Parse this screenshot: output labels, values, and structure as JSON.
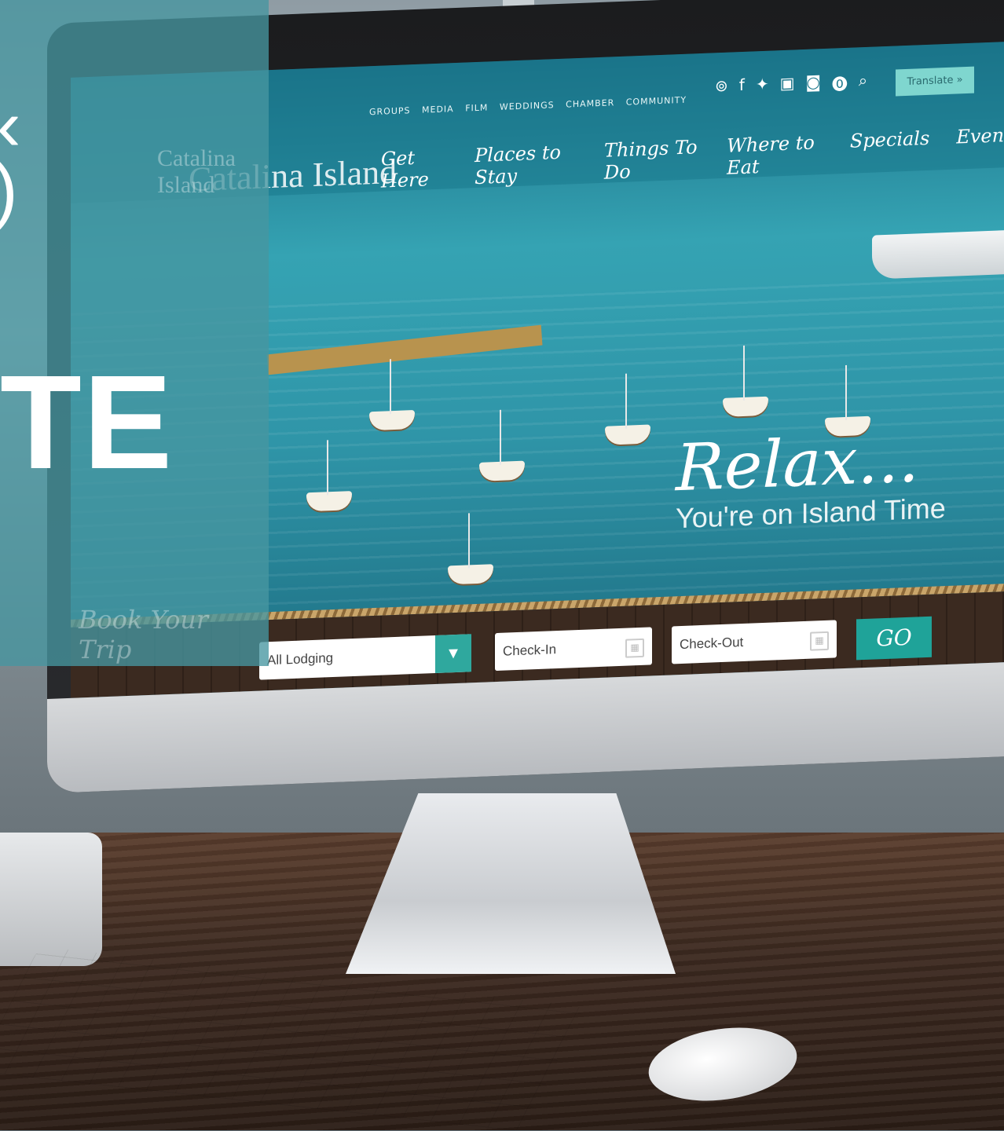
{
  "site": {
    "logo_text": "Catalina Island",
    "utility_links": [
      "GROUPS",
      "MEDIA",
      "FILM",
      "WEDDINGS",
      "CHAMBER",
      "COMMUNITY"
    ],
    "social_icons": [
      "tripadvisor-icon",
      "facebook-icon",
      "twitter-icon",
      "youtube-icon",
      "instagram-icon",
      "pinterest-icon",
      "search-icon"
    ],
    "translate_label": "Translate »",
    "nav": [
      "Get Here",
      "Places to Stay",
      "Things To Do",
      "Where to Eat",
      "Specials",
      "Events"
    ],
    "hero": {
      "title": "Relax...",
      "subtitle": "You're on Island Time"
    },
    "booking": {
      "label": "Book Your Trip",
      "lodging_value": "All Lodging",
      "checkin_placeholder": "Check-In",
      "checkout_placeholder": "Check-Out",
      "go_label": "GO"
    }
  },
  "overlay": {
    "fragment_top": "‹",
    "fragment_mid": ")",
    "big_text": "TE"
  },
  "colors": {
    "overlay": "#4696a0",
    "accent": "#1fa399",
    "translate_bg": "#7fd6cf"
  }
}
